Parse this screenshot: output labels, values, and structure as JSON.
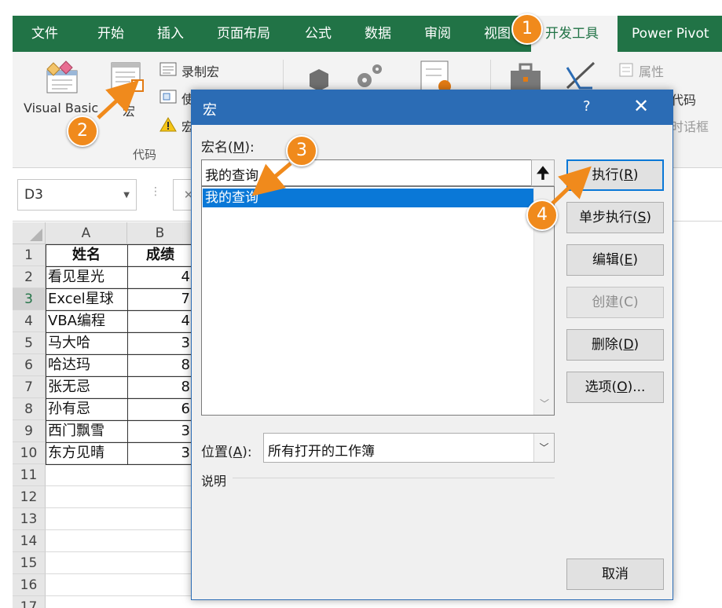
{
  "ribbon_tabs": [
    "文件",
    "开始",
    "插入",
    "页面布局",
    "公式",
    "数据",
    "审阅",
    "视图",
    "开发工具",
    "Power Pivot"
  ],
  "ribbon": {
    "visual_basic_label": "Visual Basic",
    "macro_label": "宏",
    "record_macro_label": "录制宏",
    "relative_ref_label": "使",
    "macro_security_label": "宏",
    "code_group_label": "代码",
    "properties_label": "属性",
    "view_code_label": "代码",
    "run_dialog_label": "时话框"
  },
  "formula_bar": {
    "name_box": "D3",
    "cancel_symbol": "✕"
  },
  "sheet": {
    "columns": [
      "A",
      "B"
    ],
    "rows": [
      "1",
      "2",
      "3",
      "4",
      "5",
      "6",
      "7",
      "8",
      "9",
      "10",
      "11",
      "12",
      "13",
      "14",
      "15",
      "16",
      "17"
    ],
    "selected_row": "3",
    "header": {
      "a": "姓名",
      "b": "成绩"
    },
    "data": [
      {
        "a": "看见星光",
        "b": "4"
      },
      {
        "a": "Excel星球",
        "b": "7"
      },
      {
        "a": "VBA编程",
        "b": "4"
      },
      {
        "a": "马大哈",
        "b": "3"
      },
      {
        "a": "哈达玛",
        "b": "8"
      },
      {
        "a": "张无忌",
        "b": "8"
      },
      {
        "a": "孙有忌",
        "b": "6"
      },
      {
        "a": "西门飘雪",
        "b": "3"
      },
      {
        "a": "东方见晴",
        "b": "3"
      }
    ]
  },
  "dialog": {
    "title": "宏",
    "help": "?",
    "close": "✕",
    "macro_name_label": "宏名(",
    "macro_name_key": "M",
    "macro_name_suffix": "):",
    "macro_name_value": "我的查询",
    "up_arrow": "🠉",
    "macro_list": [
      "我的查询"
    ],
    "buttons": {
      "run": {
        "pre": "执行(",
        "key": "R",
        "post": ")"
      },
      "step": {
        "pre": "单步执行(",
        "key": "S",
        "post": ")"
      },
      "edit": {
        "pre": "编辑(",
        "key": "E",
        "post": ")"
      },
      "create": {
        "pre": "创建(",
        "key": "C",
        "post": ")"
      },
      "delete": {
        "pre": "删除(",
        "key": "D",
        "post": ")"
      },
      "options": {
        "pre": "选项(",
        "key": "O",
        "post": ")..."
      },
      "cancel": "取消"
    },
    "location_label": "位置(",
    "location_key": "A",
    "location_suffix": "):",
    "location_value": "所有打开的工作簿",
    "description_label": "说明"
  },
  "steps": [
    "1",
    "2",
    "3",
    "4"
  ],
  "colors": {
    "ribbon_green": "#217346",
    "dialog_blue": "#2b6cb5",
    "selection_blue": "#0a78d7",
    "badge_orange": "#f08a1c"
  }
}
